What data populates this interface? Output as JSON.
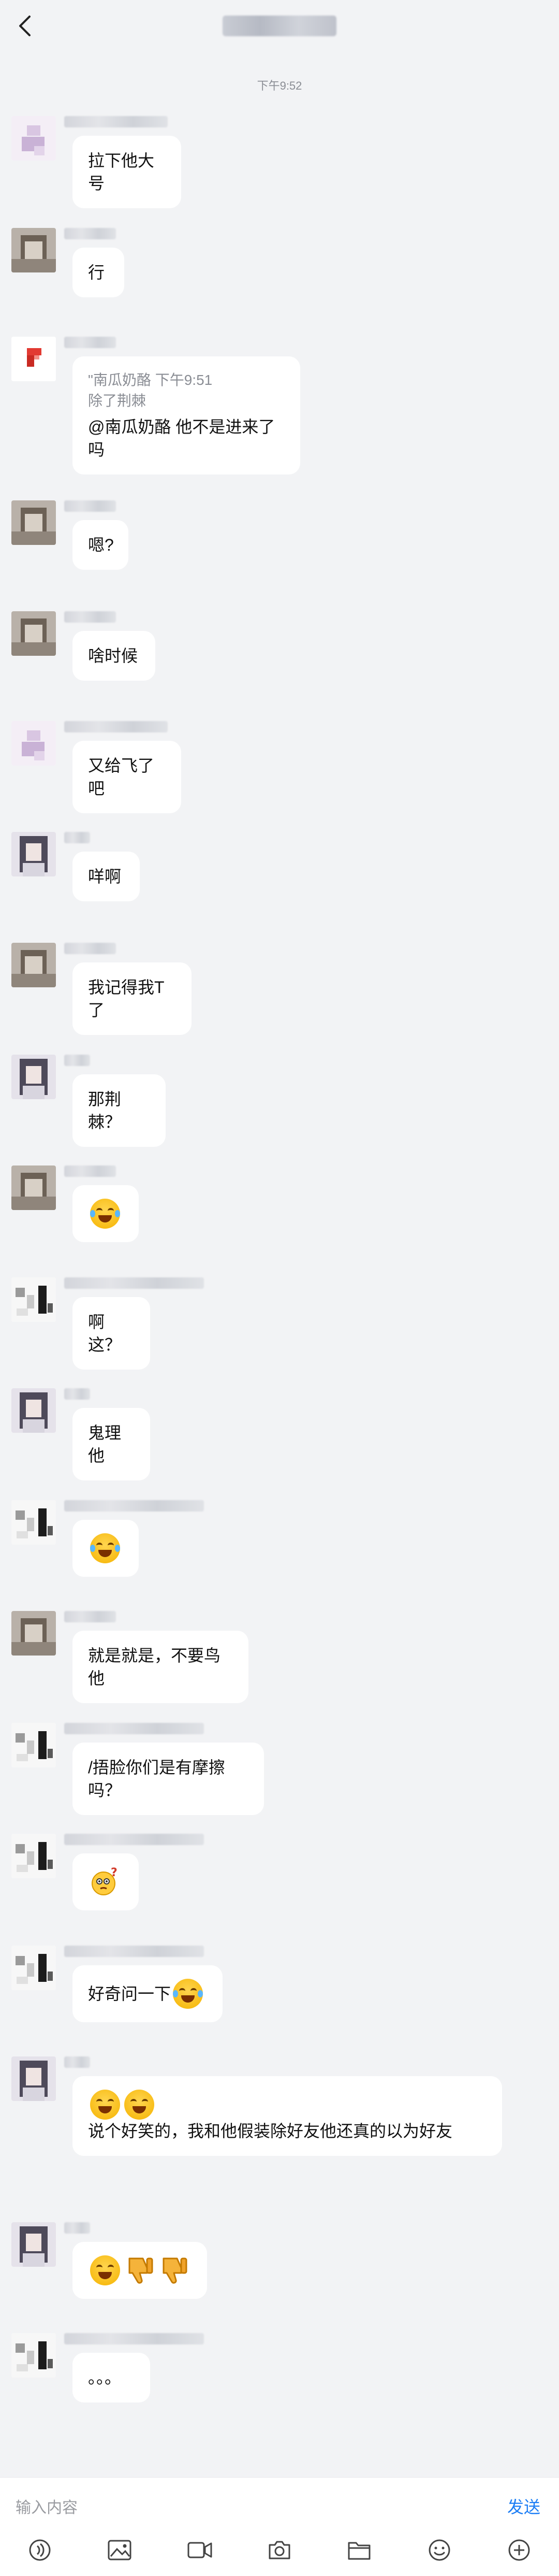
{
  "header": {
    "title": ""
  },
  "timestamp": "下午9:52",
  "messages": [
    {
      "avatar": "a",
      "text": "拉下他大号"
    },
    {
      "avatar": "b",
      "text": "行"
    },
    {
      "avatar": "c",
      "quote": {
        "line1": "\"南瓜奶酪 下午9:51",
        "line2": "除了荆棘"
      },
      "text": "@南瓜奶酪 他不是进来了吗"
    },
    {
      "avatar": "b",
      "text": "嗯?"
    },
    {
      "avatar": "b",
      "text": "啥时候"
    },
    {
      "avatar": "a",
      "text": "又给飞了吧"
    },
    {
      "avatar": "d",
      "text": "咩啊"
    },
    {
      "avatar": "b",
      "text": "我记得我T了"
    },
    {
      "avatar": "d",
      "text": "那荆棘？"
    },
    {
      "avatar": "b",
      "emoji": [
        "laugh-cry"
      ]
    },
    {
      "avatar": "e",
      "text": "啊这？"
    },
    {
      "avatar": "d",
      "text": "鬼理他"
    },
    {
      "avatar": "e",
      "emoji": [
        "laugh-cry"
      ]
    },
    {
      "avatar": "b",
      "text": "就是就是，不要鸟他"
    },
    {
      "avatar": "e",
      "text": "/捂脸你们是有摩擦吗？"
    },
    {
      "avatar": "e",
      "emoji": [
        "confused"
      ]
    },
    {
      "avatar": "e",
      "text": "好奇问一下",
      "emoji_after": [
        "laugh-cry"
      ]
    },
    {
      "avatar": "d",
      "emoji_before": [
        "grin",
        "grin"
      ],
      "text": "说个好笑的，我和他假装除好友他还真的以为好友"
    },
    {
      "avatar": "d",
      "emoji": [
        "grin",
        "thumbs-down",
        "thumbs-down"
      ]
    },
    {
      "avatar": "e",
      "text": "。。。"
    }
  ],
  "composer": {
    "placeholder": "输入内容",
    "send_label": "发送"
  },
  "toolbar_icons": [
    "voice-icon",
    "image-icon",
    "video-icon",
    "camera-icon",
    "folder-icon",
    "emoji-icon",
    "plus-icon"
  ]
}
